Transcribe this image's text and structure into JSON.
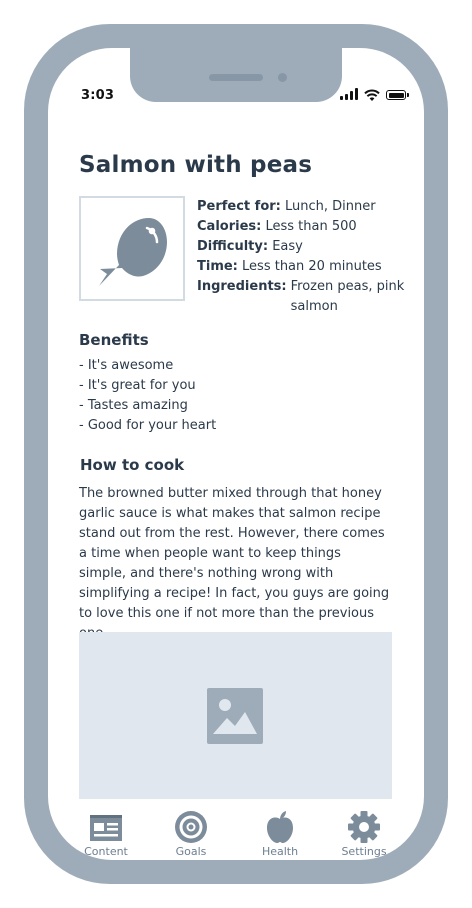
{
  "status_bar": {
    "time": "3:03"
  },
  "recipe": {
    "title": "Salmon with peas",
    "image_icon": "fish-icon",
    "details": [
      {
        "label": "Perfect for:",
        "value": "Lunch, Dinner"
      },
      {
        "label": "Calories:",
        "value": "Less than 500"
      },
      {
        "label": "Difficulty:",
        "value": "Easy"
      },
      {
        "label": "Time:",
        "value": "Less than 20 minutes"
      },
      {
        "label": "Ingredients:",
        "value": "Frozen peas, pink salmon"
      }
    ],
    "benefits_heading": "Benefits",
    "benefits": [
      "- It's awesome",
      "- It's great for you",
      "- Tastes amazing",
      "- Good for your heart"
    ],
    "how_to_cook_heading": "How to cook",
    "how_to_cook_text": "The browned butter mixed through that honey garlic sauce is what makes that salmon recipe stand out from the rest. However, there comes a time when people want to keep things simple, and there's nothing wrong with simplifying a recipe! In fact, you guys are going to love this one if not more than the previous one.",
    "image_placeholder_icon": "image-placeholder-icon"
  },
  "tabbar": {
    "tabs": [
      {
        "label": "Content",
        "icon": "newspaper-icon"
      },
      {
        "label": "Goals",
        "icon": "target-icon"
      },
      {
        "label": "Health",
        "icon": "apple-icon"
      },
      {
        "label": "Settings",
        "icon": "gear-icon"
      }
    ]
  },
  "colors": {
    "frame": "#9eacb9",
    "text": "#2b3a4a",
    "icon": "#7d8c9b",
    "placeholder_bg": "#e1e7ee"
  }
}
